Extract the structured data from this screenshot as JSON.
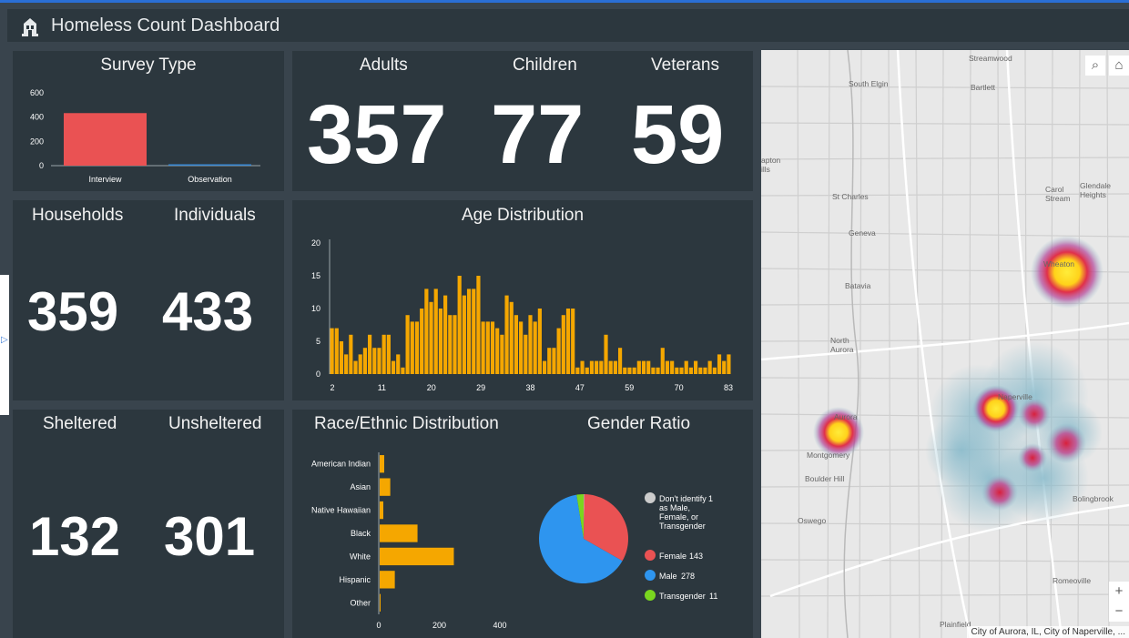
{
  "app": {
    "title": "Homeless Count Dashboard",
    "logo_icon": "building-icon"
  },
  "survey_type": {
    "title": "Survey Type",
    "chart_data": {
      "type": "bar",
      "categories": [
        "Interview",
        "Observation"
      ],
      "values": [
        433,
        5
      ],
      "yticks": [
        "600",
        "400",
        "200",
        "0"
      ],
      "ylim": [
        0,
        600
      ],
      "colors": [
        "#ea5253",
        "#3a8ad6"
      ]
    }
  },
  "counts": {
    "adults_label": "Adults",
    "adults_value": "357",
    "children_label": "Children",
    "children_value": "77",
    "veterans_label": "Veterans",
    "veterans_value": "59",
    "households_label": "Households",
    "households_value": "359",
    "individuals_label": "Individuals",
    "individuals_value": "433",
    "sheltered_label": "Sheltered",
    "sheltered_value": "132",
    "unsheltered_label": "Unsheltered",
    "unsheltered_value": "301"
  },
  "age_distribution": {
    "title": "Age Distribution",
    "chart_data": {
      "type": "bar",
      "x_tick_labels": [
        "2",
        "11",
        "20",
        "29",
        "38",
        "47",
        "59",
        "70",
        "83"
      ],
      "y_tick_labels": [
        "20",
        "15",
        "10",
        "5",
        "0"
      ],
      "ylim": [
        0,
        20
      ],
      "color": "#f5a700",
      "values": [
        7,
        7,
        5,
        3,
        6,
        2,
        3,
        4,
        6,
        4,
        4,
        6,
        6,
        2,
        3,
        1,
        9,
        8,
        8,
        10,
        13,
        11,
        13,
        10,
        12,
        9,
        9,
        15,
        12,
        13,
        13,
        15,
        8,
        8,
        8,
        7,
        6,
        12,
        11,
        9,
        8,
        6,
        9,
        8,
        10,
        2,
        4,
        4,
        7,
        9,
        10,
        10,
        1,
        2,
        1,
        2,
        2,
        2,
        6,
        2,
        2,
        4,
        1,
        1,
        1,
        2,
        2,
        2,
        1,
        1,
        4,
        2,
        2,
        1,
        1,
        2,
        1,
        2,
        1,
        1,
        2,
        1,
        3,
        2,
        3
      ]
    }
  },
  "race": {
    "title": "Race/Ethnic Distribution",
    "chart_data": {
      "type": "bar",
      "orientation": "horizontal",
      "categories": [
        "American Indian",
        "Asian",
        "Native Hawaiian",
        "Black",
        "White",
        "Hispanic",
        "Other"
      ],
      "values": [
        15,
        35,
        12,
        125,
        245,
        50,
        3
      ],
      "xticks": [
        "0",
        "200",
        "400"
      ],
      "xlim": [
        0,
        400
      ],
      "color": "#f5a700"
    }
  },
  "gender": {
    "title": "Gender Ratio",
    "chart_data": {
      "type": "pie",
      "slices": [
        {
          "label": "Don't identify as Male, Female, or Transgender",
          "value": 1,
          "value_text": "1",
          "color": "#cccccc"
        },
        {
          "label": "Female",
          "value": 143,
          "value_text": "143",
          "color": "#ea5253"
        },
        {
          "label": "Male",
          "value": 278,
          "value_text": "278",
          "color": "#2e95ef"
        },
        {
          "label": "Transgender",
          "value": 11,
          "value_text": "11",
          "color": "#7ad61f"
        }
      ]
    }
  },
  "map": {
    "search_icon": "search-icon",
    "home_icon": "home-icon",
    "zoom_in": "+",
    "zoom_out": "−",
    "attribution": "City of Aurora, IL, City of Naperville, ...",
    "places": [
      "Streamwood",
      "South Elgin",
      "Bartlett",
      "St Charles",
      "Carol Stream",
      "Glendale Heights",
      "Geneva",
      "Wheaton",
      "Batavia",
      "North Aurora",
      "Naperville",
      "Aurora",
      "Montgomery",
      "Boulder Hill",
      "Oswego",
      "Bolingbrook",
      "Romeoville",
      "Plainfield",
      "apton",
      "ills"
    ]
  }
}
